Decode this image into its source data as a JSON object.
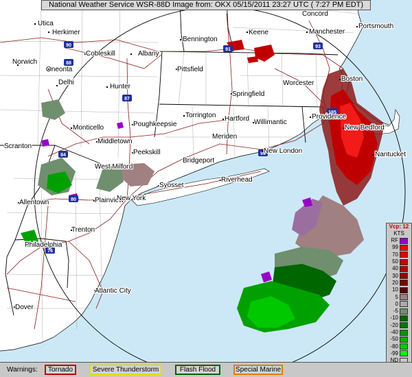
{
  "header": {
    "title": "National Weather Service WSR-88D Image from: OKX 05/15/2011 23:27 UTC ( 7:27 PM EDT)"
  },
  "cities": {
    "concord": "Concord",
    "utica": "Utica",
    "herkimer": "Herkimer",
    "bennington": "Bennington",
    "keene": "Keene",
    "manchester": "Manchester",
    "portsmouth": "Portsmouth",
    "norwich": "Norwich",
    "cobleskill": "Cobleskill",
    "albany": "Albany",
    "oneonta": "Oneonta",
    "pittsfield": "Pittsfield",
    "worcester": "Worcester",
    "boston": "Boston",
    "delhi": "Delhi",
    "hunter": "Hunter",
    "springfield": "Springfield",
    "providence": "Providence",
    "new_bedford": "New Bedford",
    "torrington": "Torrington",
    "hartford": "Hartford",
    "willimantic": "Willimantic",
    "monticello": "Monticello",
    "poughkeepsie": "Poughkeepsie",
    "middletown": "Middletown",
    "meriden": "Meriden",
    "scranton": "Scranton",
    "new_london": "New London",
    "nantucket": "Nantucket",
    "peekskill": "Peekskill",
    "bridgeport": "Bridgeport",
    "west_milford": "West Milford",
    "syosset": "Syosset",
    "riverhead": "Riverhead",
    "allentown": "Allentown",
    "plainview": "Plainview",
    "new_york": "New York",
    "trenton": "Trenton",
    "philadelphia": "Philadelphia",
    "atlantic_city": "Atlantic City",
    "dover": "Dover"
  },
  "highways": [
    "90",
    "88",
    "91",
    "93",
    "87",
    "84",
    "95",
    "80",
    "76",
    "195"
  ],
  "legend": {
    "mode": "Vcp: 12",
    "unit": "KTS",
    "rows": [
      {
        "label": "RF",
        "color": "#9a00c8"
      },
      {
        "label": "99",
        "color": "#ff0000"
      },
      {
        "label": "70",
        "color": "#e60000"
      },
      {
        "label": "50",
        "color": "#c80000"
      },
      {
        "label": "40",
        "color": "#b40000"
      },
      {
        "label": "30",
        "color": "#960000"
      },
      {
        "label": "20",
        "color": "#800000"
      },
      {
        "label": "10",
        "color": "#5a0000"
      },
      {
        "label": "5",
        "color": "#a08080"
      },
      {
        "label": "0",
        "color": "#aaaaaa"
      },
      {
        "label": "-5",
        "color": "#6f8f6f"
      },
      {
        "label": "-10",
        "color": "#006600"
      },
      {
        "label": "-20",
        "color": "#007a00"
      },
      {
        "label": "-40",
        "color": "#009900"
      },
      {
        "label": "-50",
        "color": "#00b000"
      },
      {
        "label": "-80",
        "color": "#00cc00"
      },
      {
        "label": "-99",
        "color": "#00ff00"
      },
      {
        "label": "ND",
        "color": "#c8c8c8"
      }
    ]
  },
  "warnings": {
    "label": "Warnings:",
    "tornado": "Tornado",
    "severe": "Severe Thunderstorm",
    "flash": "Flash Flood",
    "marine": "Special Marine",
    "colors": {
      "tornado": "#c00000",
      "severe": "#e0e000",
      "flash": "#006400",
      "marine": "#e08000"
    }
  },
  "colors": {
    "ocean": "#cce8f7",
    "land": "#ffffff",
    "roads": "#8b1a1a",
    "borders": "#000000"
  }
}
